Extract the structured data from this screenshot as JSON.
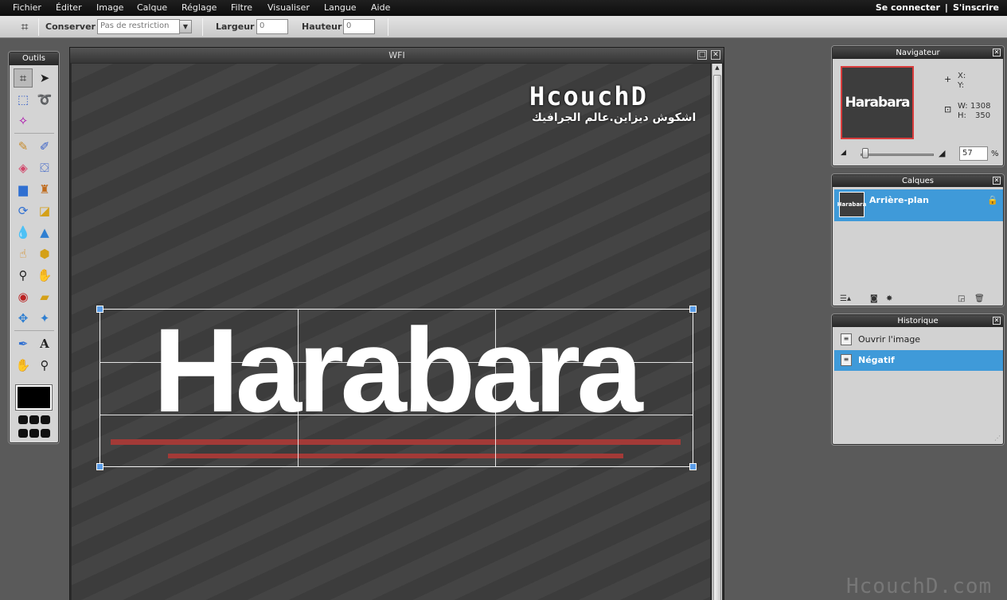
{
  "menu": {
    "items": [
      "Fichier",
      "Éditer",
      "Image",
      "Calque",
      "Réglage",
      "Filtre",
      "Visualiser",
      "Langue",
      "Aide"
    ],
    "login": "Se connecter",
    "separator": "|",
    "register": "S'inscrire"
  },
  "options": {
    "keep_label": "Conserver :",
    "keep_value": "Pas de restriction",
    "width_label": "Largeur :",
    "width_value": "0",
    "height_label": "Hauteur :",
    "height_value": "0"
  },
  "tools": {
    "title": "Outils",
    "items": [
      "crop-icon",
      "move-icon",
      "marquee-icon",
      "lasso-icon",
      "magic-wand-icon",
      "pencil-icon",
      "brush-icon",
      "eraser-icon",
      "paint-bucket-icon",
      "gradient-icon",
      "clone-stamp-icon",
      "color-replace-icon",
      "drawing-icon",
      "blur-icon",
      "sharpen-icon",
      "smudge-icon",
      "sponge-icon",
      "dodge-icon",
      "burn-icon",
      "red-eye-icon",
      "spot-heal-icon",
      "bloat-icon",
      "pinch-icon",
      "color-picker-icon",
      "type-icon",
      "hand-icon",
      "zoom-icon"
    ],
    "fg_color": "#000000"
  },
  "document": {
    "title": "WFI",
    "logo_text": "HcouchD",
    "logo_subtext": "اشكوش ديزاين.عالم الجرافيك",
    "art_text": "Harabara",
    "accent_red": "#a33a37"
  },
  "watermark": "HcouchD.com",
  "navigator": {
    "title": "Navigateur",
    "thumb_text": "Harabara",
    "x_label": "X:",
    "y_label": "Y:",
    "w_label": "W:",
    "w_value": "1308",
    "h_label": "H:",
    "h_value": "350",
    "zoom": "57",
    "zoom_unit": "%",
    "zoom_fraction": 0.1
  },
  "layers": {
    "title": "Calques",
    "items": [
      {
        "name": "Arrière-plan",
        "thumb_text": "Harabara",
        "locked": true
      }
    ]
  },
  "history": {
    "title": "Historique",
    "items": [
      {
        "label": "Ouvrir l'image"
      },
      {
        "label": "Négatif"
      }
    ],
    "selected_index": 1
  },
  "colors": {
    "selection": "#3f9ad9"
  }
}
